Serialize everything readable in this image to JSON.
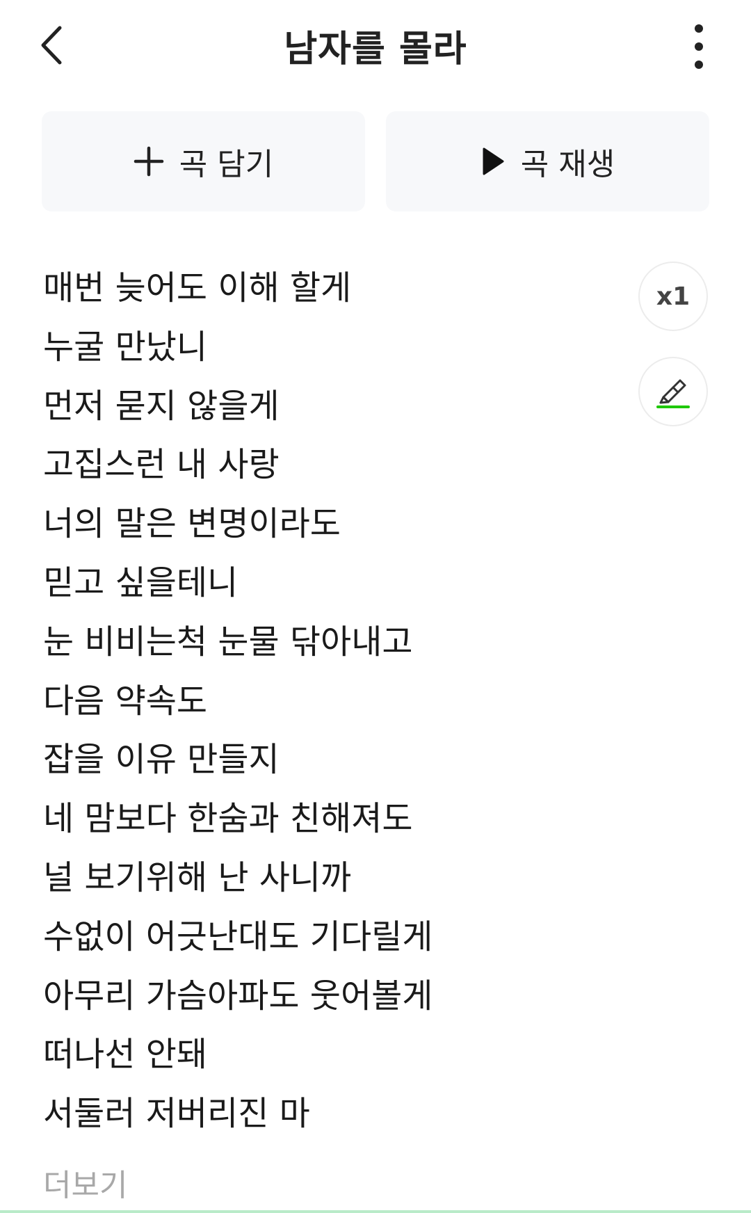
{
  "header": {
    "title": "남자를 몰라",
    "back_icon": "chevron-left-icon",
    "more_icon": "vertical-ellipsis-icon"
  },
  "actions": {
    "add_label": "곡 담기",
    "add_icon": "plus-icon",
    "play_label": "곡 재생",
    "play_icon": "play-icon"
  },
  "side_controls": {
    "speed_label": "x1",
    "highlight_icon": "highlighter-pen-icon",
    "highlight_accent": "#1ec800"
  },
  "lyrics": [
    "매번 늦어도 이해 할게",
    "누굴 만났니",
    "먼저 묻지 않을게",
    "고집스런 내 사랑",
    "너의 말은 변명이라도",
    "믿고 싶을테니",
    "눈 비비는척 눈물 닦아내고",
    "다음 약속도",
    "잡을 이유 만들지",
    "네 맘보다 한숨과 친해져도",
    "널 보기위해 난 사니까",
    "수없이 어긋난대도 기다릴게",
    "아무리 가슴아파도 웃어볼게",
    "떠나선 안돼",
    "서둘러 저버리진 마"
  ],
  "more_label": "더보기",
  "colors": {
    "button_bg": "#f7f8fa",
    "text": "#1a1a1a",
    "muted": "#a8a8a8",
    "accent_green": "#1ec800"
  }
}
